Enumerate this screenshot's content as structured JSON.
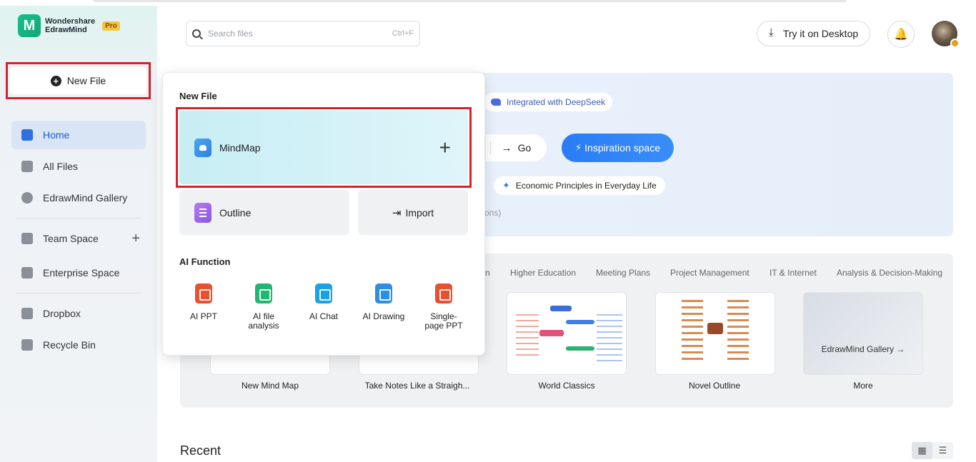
{
  "app": {
    "brand_line1": "Wondershare",
    "brand_line2": "EdrawMind",
    "badge": "Pro",
    "logo_icon": "edrawmind-logo-icon"
  },
  "sidebar": {
    "new_file_label": "New File",
    "items": [
      {
        "label": "Home",
        "icon": "home-icon",
        "active": true
      },
      {
        "label": "All Files",
        "icon": "file-icon"
      },
      {
        "label": "EdrawMind Gallery",
        "icon": "gallery-icon"
      },
      {
        "label": "Team Space",
        "icon": "team-icon"
      },
      {
        "label": "Enterprise Space",
        "icon": "building-icon"
      },
      {
        "label": "Dropbox",
        "icon": "dropbox-icon"
      },
      {
        "label": "Recycle Bin",
        "icon": "trash-icon"
      }
    ]
  },
  "header": {
    "search_placeholder": "Search files",
    "search_shortcut": "Ctrl+F",
    "desktop_label": "Try it on Desktop"
  },
  "hero": {
    "deepseek_tag": "Integrated with DeepSeek",
    "go_label": "Go",
    "inspiration_label": "Inspiration space",
    "suggestion": "Economic Principles in Everyday Life",
    "partial_text": "ons)"
  },
  "gallery": {
    "tabs": [
      "n",
      "Higher Education",
      "Meeting Plans",
      "Project Management",
      "IT & Internet",
      "Analysis & Decision-Making"
    ],
    "cards": [
      "New Mind Map",
      "Take Notes Like a Straigh...",
      "World Classics",
      "Novel Outline",
      "More"
    ],
    "more_card_text": "EdrawMind Gallery"
  },
  "recent": {
    "title": "Recent"
  },
  "popup": {
    "title": "New File",
    "mindmap_label": "MindMap",
    "outline_label": "Outline",
    "import_label": "Import",
    "ai_title": "AI Function",
    "ai_items": [
      {
        "line1": "AI PPT",
        "line2": "",
        "color": "#e8502f"
      },
      {
        "line1": "AI file",
        "line2": "analysis",
        "color": "#22b573"
      },
      {
        "line1": "AI Chat",
        "line2": "",
        "color": "#1aa2e8"
      },
      {
        "line1": "AI Drawing",
        "line2": "",
        "color": "#2c8fe6"
      },
      {
        "line1": "Single-",
        "line2": "page PPT",
        "color": "#e8502f"
      }
    ]
  },
  "colors": {
    "accent": "#2a7cf6",
    "highlight_border": "#d7202c",
    "active_nav": "#d9e4f5"
  }
}
